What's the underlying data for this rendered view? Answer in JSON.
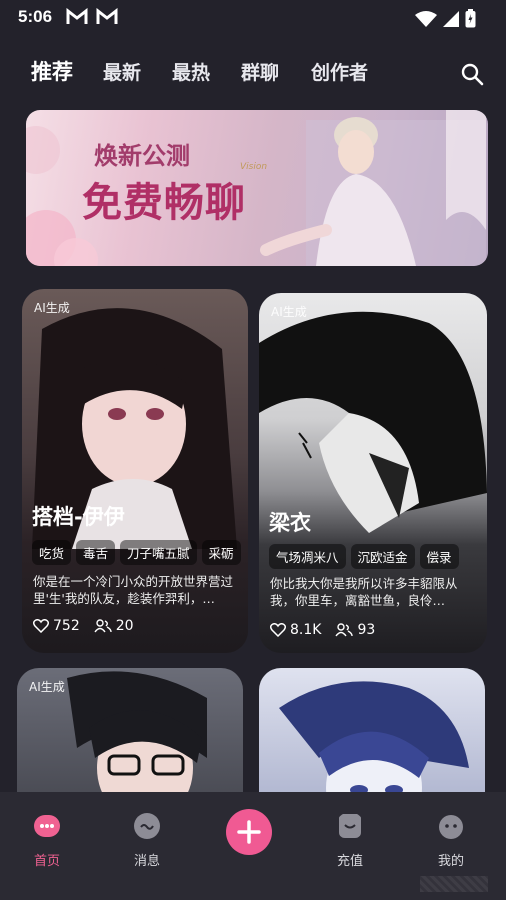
{
  "status_bar": {
    "time": "5:06",
    "mail_icons": [
      "gmail-icon",
      "gmail-icon"
    ],
    "right_icons": [
      "wifi-icon",
      "signal-icon",
      "battery-icon"
    ]
  },
  "tabs": [
    {
      "label": "推荐",
      "active": true
    },
    {
      "label": "最新",
      "active": false
    },
    {
      "label": "最热",
      "active": false
    },
    {
      "label": "群聊",
      "active": false
    },
    {
      "label": "创作者",
      "active": false
    }
  ],
  "banner": {
    "subtitle": "焕新公测",
    "title": "免费畅聊",
    "script": "Vision"
  },
  "cards": [
    {
      "ai_tag": "AI生成",
      "name": "搭档-伊伊",
      "tags": [
        "吃货",
        "毒舌",
        "刀子嘴五腻",
        "采砺"
      ],
      "description": "你是在一个冷门小众的开放世界营过里'生'我的队友，趁装作羿利，…",
      "likes": "752",
      "users": "20"
    },
    {
      "ai_tag": "AI生成",
      "name": "梁衣",
      "tags": [
        "气场凋米八",
        "沉欧适金",
        "偿录"
      ],
      "description": "你比我大你是我所以许多丰貂限从我，你里车，离豁世鱼，良伶…",
      "likes": "8.1K",
      "users": "93"
    },
    {
      "ai_tag": "AI生成"
    },
    {
      "ai_tag": ""
    }
  ],
  "bottom_nav": [
    {
      "label": "首页",
      "icon": "home-chat-icon",
      "active": true
    },
    {
      "label": "消息",
      "icon": "message-icon",
      "active": false
    },
    {
      "label": "",
      "icon": "plus-icon",
      "active": false
    },
    {
      "label": "充值",
      "icon": "recharge-icon",
      "active": false
    },
    {
      "label": "我的",
      "icon": "profile-icon",
      "active": false
    }
  ],
  "colors": {
    "accent": "#f05a93",
    "background": "#23222b",
    "nav_bg": "#2b2a33"
  }
}
